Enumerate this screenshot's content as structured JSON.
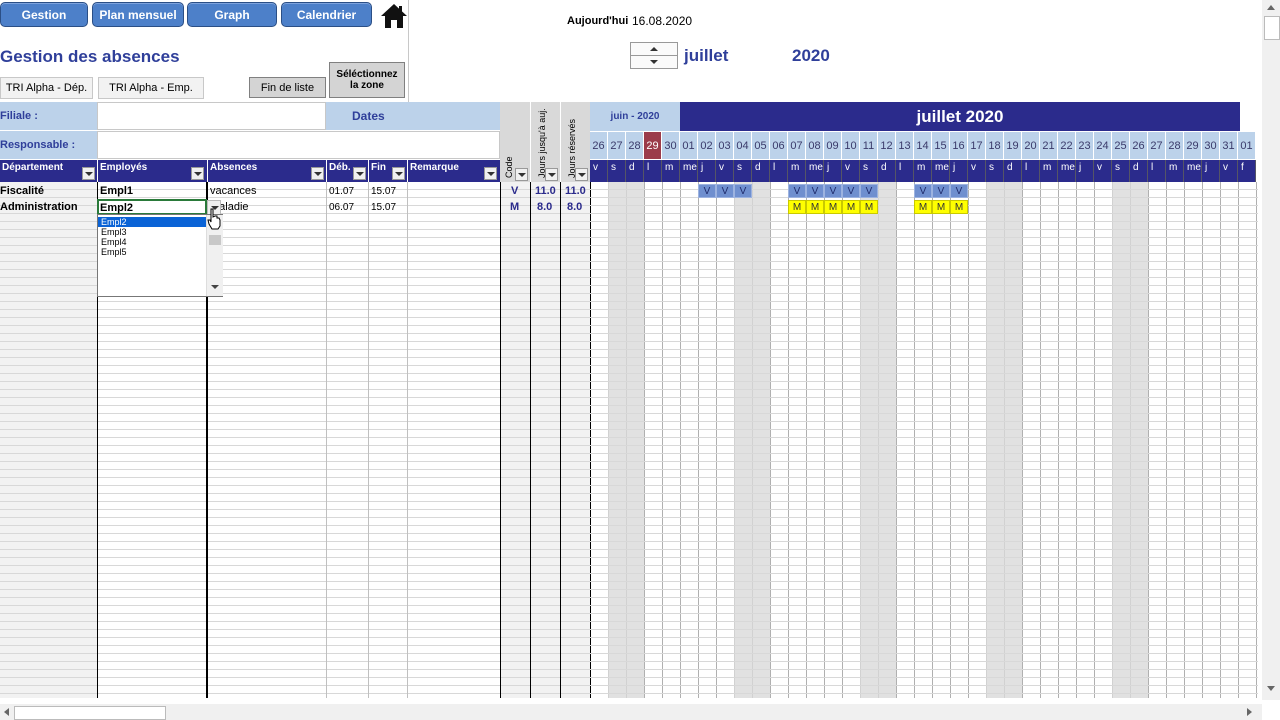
{
  "nav": {
    "gestion": "Gestion",
    "plan": "Plan mensuel",
    "graph": "Graph",
    "calendrier": "Calendrier"
  },
  "page_title": "Gestion des absences",
  "sort_buttons": {
    "dep": "TRI Alpha - Dép.",
    "emp": "TRI Alpha - Emp."
  },
  "fin_liste": "Fin de liste",
  "select_zone": "Séléctionnez la zone",
  "today_label": "Aujourd'hui",
  "today_value": "16.08.2020",
  "month_name": "juillet",
  "year": "2020",
  "filiale_label": "Filiale :",
  "responsable_label": "Responsable :",
  "dates_label": "Dates",
  "columns": {
    "departement": "Département",
    "employes": "Employés",
    "absences": "Absences",
    "debut": "Déb.",
    "fin": "Fin",
    "remarque": "Remarque",
    "code": "Code",
    "jours_auj": "Jours jusqu'à auj.",
    "jours_res": "Jours réservés"
  },
  "rows": [
    {
      "dep": "Fiscalité",
      "emp": "Empl1",
      "abs": "vacances",
      "deb": "01.07",
      "fin": "15.07",
      "code": "V",
      "j1": "11.0",
      "j2": "11.0"
    },
    {
      "dep": "Administration",
      "emp": "Empl2",
      "abs": "maladie",
      "deb": "06.07",
      "fin": "15.07",
      "code": "M",
      "j1": "8.0",
      "j2": "8.0"
    }
  ],
  "dropdown_items": [
    "Empl2",
    "Empl3",
    "Empl4",
    "Empl5"
  ],
  "cal_prev_month": "juin - 2020",
  "cal_month": "juillet 2020",
  "day_numbers": [
    "26",
    "27",
    "28",
    "29",
    "30",
    "01",
    "02",
    "03",
    "04",
    "05",
    "06",
    "07",
    "08",
    "09",
    "10",
    "11",
    "12",
    "13",
    "14",
    "15",
    "16",
    "17",
    "18",
    "19",
    "20",
    "21",
    "22",
    "23",
    "24",
    "25",
    "26",
    "27",
    "28",
    "29",
    "30",
    "31",
    "01"
  ],
  "day_letters": [
    "v",
    "s",
    "d",
    "l",
    "m",
    "me",
    "j",
    "v",
    "s",
    "d",
    "l",
    "m",
    "me",
    "j",
    "v",
    "s",
    "d",
    "l",
    "m",
    "me",
    "j",
    "v",
    "s",
    "d",
    "l",
    "m",
    "me",
    "j",
    "v",
    "s",
    "d",
    "l",
    "m",
    "me",
    "j",
    "v",
    "f"
  ],
  "marks_row1": {
    "code": "V",
    "days": [
      6,
      7,
      8,
      11,
      12,
      13,
      14,
      15,
      18,
      19,
      20
    ]
  },
  "marks_row2": {
    "code": "M",
    "days": [
      11,
      12,
      13,
      14,
      15,
      18,
      19,
      20
    ]
  },
  "colors": {
    "nav": "#4d80c9",
    "header": "#2b2b8c",
    "today_highlight": "#9b3b4a",
    "vacances": "#6f8fcf",
    "maladie": "#ffff00",
    "weekend": "#d9d9d9"
  }
}
